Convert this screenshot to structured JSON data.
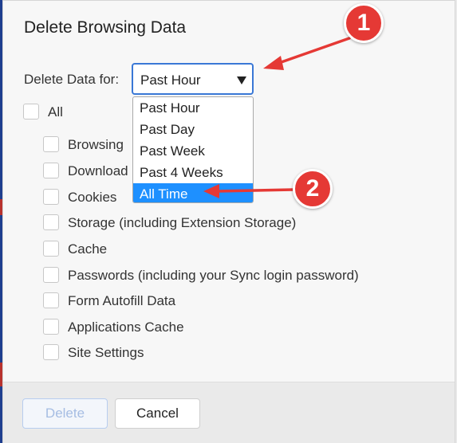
{
  "dialog": {
    "title": "Delete Browsing Data",
    "range_label": "Delete Data for:",
    "range_select": {
      "value": "Past Hour",
      "options": [
        "Past Hour",
        "Past Day",
        "Past Week",
        "Past 4 Weeks",
        "All Time"
      ],
      "highlighted": "All Time"
    },
    "all_label": "All",
    "items": [
      "Browsing",
      "Download",
      "Cookies",
      "Storage (including Extension Storage)",
      "Cache",
      "Passwords (including your Sync login password)",
      "Form Autofill Data",
      "Applications Cache",
      "Site Settings"
    ],
    "buttons": {
      "delete": "Delete",
      "cancel": "Cancel"
    }
  },
  "annotations": {
    "badge_1": "1",
    "badge_2": "2"
  },
  "colors": {
    "accent": "#1e90ff",
    "select_border": "#3a78d6",
    "annotation_red": "#e53935"
  }
}
